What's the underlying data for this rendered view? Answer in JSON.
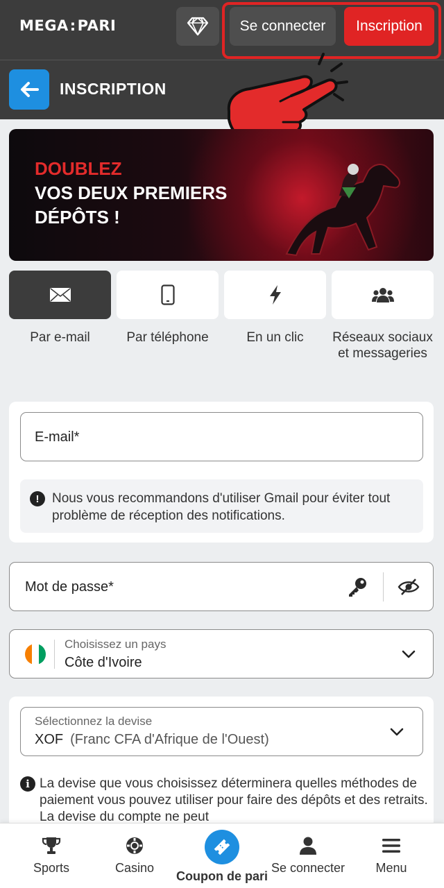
{
  "topbar": {
    "logo_left": "MEGA",
    "logo_sep": ":",
    "logo_right": "PARI",
    "gem_icon": "diamond-icon",
    "login_label": "Se connecter",
    "signup_label": "Inscription"
  },
  "header": {
    "title": "INSCRIPTION",
    "back_icon": "arrow-left-icon"
  },
  "banner": {
    "line1": "DOUBLEZ",
    "line2": "VOS DEUX PREMIERS",
    "line3": "DÉPÔTS !"
  },
  "methods": [
    {
      "label": "Par e-mail",
      "icon": "envelope-icon",
      "active": true
    },
    {
      "label": "Par téléphone",
      "icon": "phone-icon",
      "active": false
    },
    {
      "label": "En un clic",
      "icon": "lightning-icon",
      "active": false
    },
    {
      "label": "Réseaux sociaux et messageries",
      "icon": "users-icon",
      "active": false
    }
  ],
  "email_form": {
    "email_placeholder": "E-mail*",
    "gmail_notice": "Nous vous recommandons d'utiliser Gmail pour éviter tout problème de réception des notifications."
  },
  "password": {
    "placeholder": "Mot de passe*"
  },
  "country": {
    "label": "Choisissez un pays",
    "value": "Côte d'Ivoire"
  },
  "currency": {
    "label": "Sélectionnez la devise",
    "code": "XOF",
    "name": "(Franc CFA d'Afrique de l'Ouest)",
    "note": "La devise que vous choisissez déterminera quelles méthodes de paiement vous pouvez utiliser pour faire des dépôts et des retraits. La devise du compte ne peut"
  },
  "bottom_nav": {
    "sports": "Sports",
    "casino": "Casino",
    "coupon": "Coupon de pari",
    "login": "Se connecter",
    "menu": "Menu"
  },
  "colors": {
    "accent_red": "#e02424",
    "accent_blue": "#1e8fe0",
    "dark_bar": "#3c3c3c"
  }
}
